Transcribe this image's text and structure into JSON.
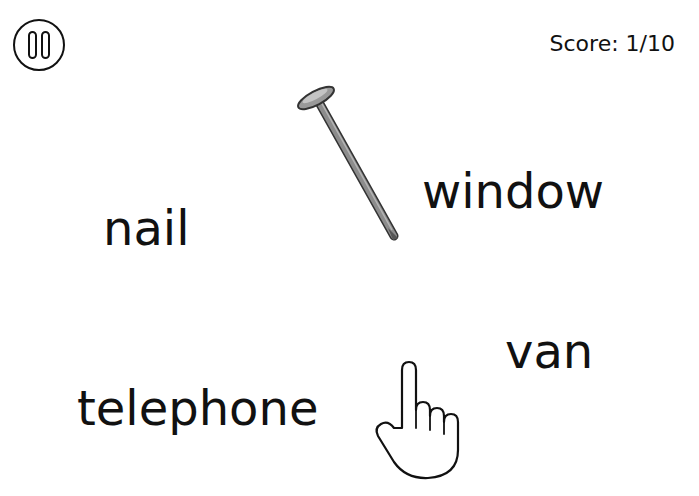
{
  "score": "Score: 1/10",
  "words": [
    {
      "text": "nail"
    },
    {
      "text": "window"
    },
    {
      "text": "van"
    },
    {
      "text": "telephone"
    }
  ]
}
